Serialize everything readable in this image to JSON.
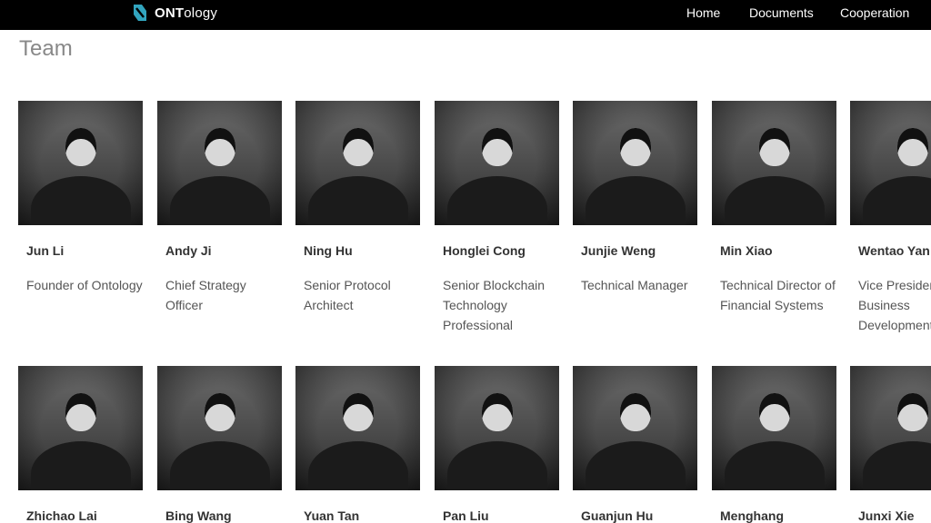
{
  "header": {
    "brand_bold": "ONT",
    "brand_light": "ology",
    "nav": [
      "Home",
      "Documents",
      "Cooperation"
    ]
  },
  "main": {
    "title": "Team",
    "members": [
      {
        "name": "Jun Li",
        "role": "Founder of Ontology"
      },
      {
        "name": "Andy Ji",
        "role": "Chief Strategy Officer"
      },
      {
        "name": "Ning Hu",
        "role": "Senior Protocol Architect"
      },
      {
        "name": "Honglei Cong",
        "role": "Senior Blockchain Technology Professional"
      },
      {
        "name": "Junjie Weng",
        "role": "Technical Manager"
      },
      {
        "name": "Min Xiao",
        "role": "Technical Director of Financial Systems"
      },
      {
        "name": "Wentao Yan",
        "role": "Vice President of Business Development"
      },
      {
        "name": "Zhichao Lai"
      },
      {
        "name": "Bing Wang"
      },
      {
        "name": "Yuan Tan"
      },
      {
        "name": "Pan Liu"
      },
      {
        "name": "Guanjun Hu"
      },
      {
        "name": "Menghang"
      },
      {
        "name": "Junxi Xie"
      }
    ]
  },
  "colors": {
    "header_bg": "#000000",
    "logo_accent": "#32a4be",
    "title": "#888888"
  }
}
